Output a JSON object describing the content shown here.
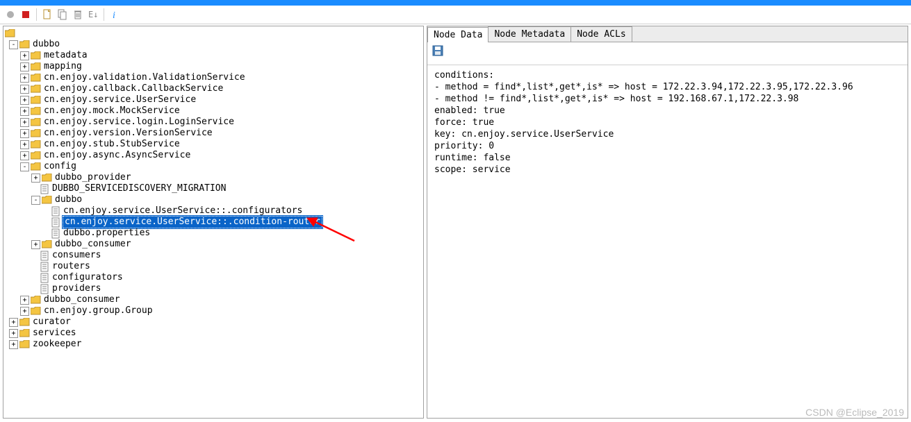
{
  "toolbar": {
    "record_tip": "●",
    "stop_tip": "■",
    "new_tip": "new",
    "copy_tip": "copy",
    "delete_tip": "delete",
    "edit_tip": "edit",
    "info_tip": "i"
  },
  "tree": {
    "root": "/",
    "dubbo": "dubbo",
    "metadata": "metadata",
    "mapping": "mapping",
    "validation": "cn.enjoy.validation.ValidationService",
    "callback": "cn.enjoy.callback.CallbackService",
    "userservice": "cn.enjoy.service.UserService",
    "mock": "cn.enjoy.mock.MockService",
    "login": "cn.enjoy.service.login.LoginService",
    "version": "cn.enjoy.version.VersionService",
    "stub": "cn.enjoy.stub.StubService",
    "async": "cn.enjoy.async.AsyncService",
    "config": "config",
    "dubbo_provider": "dubbo_provider",
    "migration": "DUBBO_SERVICEDISCOVERY_MIGRATION",
    "dubbo_inner": "dubbo",
    "configurators": "cn.enjoy.service.UserService::.configurators",
    "condition_router": "cn.enjoy.service.UserService::.condition-router",
    "properties": "dubbo.properties",
    "dubbo_consumer": "dubbo_consumer",
    "consumers": "consumers",
    "routers": "routers",
    "configurators2": "configurators",
    "providers": "providers",
    "dubbo_consumer2": "dubbo_consumer",
    "group": "cn.enjoy.group.Group",
    "curator": "curator",
    "services": "services",
    "zookeeper": "zookeeper"
  },
  "tabs": {
    "node_data": "Node Data",
    "node_metadata": "Node Metadata",
    "node_acls": "Node ACLs"
  },
  "node_data": "conditions:\n- method = find*,list*,get*,is* => host = 172.22.3.94,172.22.3.95,172.22.3.96\n- method != find*,list*,get*,is* => host = 192.168.67.1,172.22.3.98\nenabled: true\nforce: true\nkey: cn.enjoy.service.UserService\npriority: 0\nruntime: false\nscope: service",
  "watermark": "CSDN @Eclipse_2019"
}
